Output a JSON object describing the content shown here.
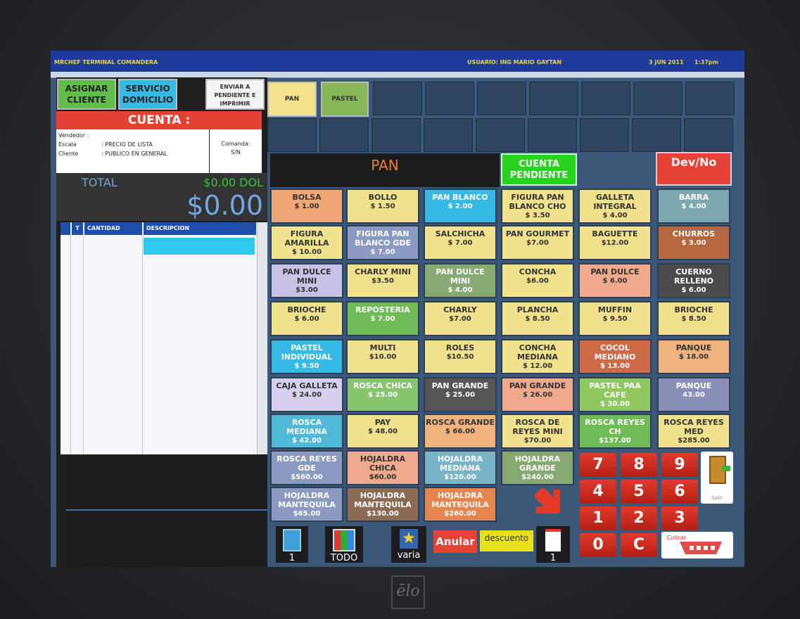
{
  "window": {
    "title": "MRCHEF TERMINAL COMANDERA",
    "user": "USUARIO: ING MARIO GAYTAN",
    "date": "3 JUN 2011",
    "time": "1:37pm"
  },
  "actions": {
    "assign_client": "ASIGNAR CLIENTE",
    "home_service": "SERVICIO DOMICILIO",
    "send_pending": "ENVIAR A PENDIENTE E IMPRIMIR"
  },
  "account": {
    "header": "CUENTA :",
    "vendor_label": "Vendedor :",
    "scale_label": "Escala",
    "scale_value": ": PRECIO DE LISTA",
    "client_label": "Cliente",
    "client_value": ": PUBLICO EN GENERAL",
    "comanda_label": "Comanda:",
    "comanda_value": "S/N",
    "total_label": "TOTAL",
    "total_dol": "$0.00 DOL",
    "total_big": "$0.00"
  },
  "order_table": {
    "col_t": "T",
    "col_qty": "CANTIDAD",
    "col_desc": "DESCRIPCION"
  },
  "categories": [
    {
      "label": "PAN",
      "color": "#f2e38a"
    },
    {
      "label": "PASTEL",
      "color": "#86b857"
    }
  ],
  "category_title": "PAN",
  "pending_button": "CUENTA PENDIENTE",
  "devno_button": "Dev/No",
  "products": [
    {
      "name": "BOLSA",
      "price": "$ 1.00",
      "color": "#efa774"
    },
    {
      "name": "BOLLO",
      "price": "$ 1.50",
      "color": "#f0e18c"
    },
    {
      "name": "PAN BLANCO",
      "price": "$ 2.00",
      "color": "#37b9e6"
    },
    {
      "name": "FIGURA PAN BLANCO CHO",
      "price": "$ 3.50",
      "color": "#f0e18c"
    },
    {
      "name": "GALLETA INTEGRAL",
      "price": "$ 4.00",
      "color": "#f0e18c"
    },
    {
      "name": "BARRA",
      "price": "$ 4.00",
      "color": "#7ea8b0"
    },
    {
      "name": "FIGURA AMARILLA",
      "price": "$ 10.00",
      "color": "#f0e18c"
    },
    {
      "name": "FIGURA PAN BLANCO GDE",
      "price": "$ 7.00",
      "color": "#8a9ac0"
    },
    {
      "name": "SALCHICHA",
      "price": "$ 7.00",
      "color": "#f0e18c"
    },
    {
      "name": "PAN GOURMET",
      "price": "$7.00",
      "color": "#f0e18c"
    },
    {
      "name": "BAGUETTE",
      "price": "$12.00",
      "color": "#f0e18c"
    },
    {
      "name": "CHURROS",
      "price": "$ 3.00",
      "color": "#b5673e"
    },
    {
      "name": "PAN DULCE MINI",
      "price": "$3.00",
      "color": "#c7c2e6"
    },
    {
      "name": "CHARLY MINI",
      "price": "$3.50",
      "color": "#f0e18c"
    },
    {
      "name": "PAN DULCE MINI",
      "price": "$ 4.00",
      "color": "#86aa72"
    },
    {
      "name": "CONCHA",
      "price": "$6.00",
      "color": "#f0e18c"
    },
    {
      "name": "PAN DULCE",
      "price": "$ 6.00",
      "color": "#efa98c"
    },
    {
      "name": "CUERNO RELLENO",
      "price": "$ 6.00",
      "color": "#4b4b4b"
    },
    {
      "name": "BRIOCHE",
      "price": "$ 6.00",
      "color": "#f0e18c"
    },
    {
      "name": "REPOSTERIA",
      "price": "$ 7.00",
      "color": "#6fbb56"
    },
    {
      "name": "CHARLY",
      "price": "$7.00",
      "color": "#f0e18c"
    },
    {
      "name": "PLANCHA",
      "price": "$ 8.50",
      "color": "#f0e18c"
    },
    {
      "name": "MUFFIN",
      "price": "$ 9.50",
      "color": "#f0e18c"
    },
    {
      "name": "BRIOCHE",
      "price": "$ 8.50",
      "color": "#f0e18c"
    },
    {
      "name": "PASTEL INDIVIDUAL",
      "price": "$ 9.50",
      "color": "#37b9e6"
    },
    {
      "name": "MULTI",
      "price": "$10.00",
      "color": "#f0e18c"
    },
    {
      "name": "ROLES",
      "price": "$10.50",
      "color": "#f0e18c"
    },
    {
      "name": "CONCHA MEDIANA",
      "price": "$ 12.00",
      "color": "#f0e18c"
    },
    {
      "name": "COCOL MEDIANO",
      "price": "$ 13.00",
      "color": "#cc6b46"
    },
    {
      "name": "PANQUE",
      "price": "$ 18.00",
      "color": "#efb37d"
    },
    {
      "name": "CAJA GALLETA",
      "price": "$ 24.00",
      "color": "#d6d0ec"
    },
    {
      "name": "ROSCA CHICA",
      "price": "$ 25.00",
      "color": "#86c46e"
    },
    {
      "name": "PAN GRANDE",
      "price": "$ 25.00",
      "color": "#555555"
    },
    {
      "name": "PAN GRANDE",
      "price": "$ 26.00",
      "color": "#efa98c"
    },
    {
      "name": "PASTEL PAA CAFE",
      "price": "$ 30.00",
      "color": "#8ec85f"
    },
    {
      "name": "PANQUE",
      "price": "43.00",
      "color": "#8a8fb8"
    },
    {
      "name": "ROSCA MEDIANA",
      "price": "$ 42.00",
      "color": "#4fbad8"
    },
    {
      "name": "PAY",
      "price": "$ 48.00",
      "color": "#f0e18c"
    },
    {
      "name": "ROSCA GRANDE",
      "price": "$ 66.00",
      "color": "#efb37d"
    },
    {
      "name": "ROSCA DE REYES MINI",
      "price": "$70.00",
      "color": "#f0e18c"
    },
    {
      "name": "ROSCA REYES CH",
      "price": "$137.00",
      "color": "#6fbb56"
    },
    {
      "name": "ROSCA REYES MED",
      "price": "$285.00",
      "color": "#f0e18c"
    },
    {
      "name": "ROSCA REYES GDE",
      "price": "$560.00",
      "color": "#8a9ac0"
    },
    {
      "name": "HOJALDRA CHICA",
      "price": "$60.00",
      "color": "#efa98c"
    },
    {
      "name": "HOJALDRA MEDIANA",
      "price": "$120.00",
      "color": "#7ab4c7"
    },
    {
      "name": "HOJALDRA GRANDE",
      "price": "$240.00",
      "color": "#86aa72"
    },
    {
      "name": "HOJALDRA MANTEQUILA",
      "price": "$65.00",
      "color": "#8a9ac0"
    },
    {
      "name": "HOJALDRA MANTEQUILA",
      "price": "$130.00",
      "color": "#8c6b55"
    },
    {
      "name": "HOJALDRA MANTEQUILA",
      "price": "$260.00",
      "color": "#e5864f"
    }
  ],
  "keypad": [
    "7",
    "8",
    "9",
    "4",
    "5",
    "6",
    "1",
    "2",
    "3",
    "0",
    "C"
  ],
  "toolbar": {
    "page_left": "1",
    "all": "TODO",
    "various": "varia",
    "cancel": "Anular",
    "discount": "descuento",
    "page_right": "1",
    "exit": "Salir",
    "basket": "Cobrar"
  }
}
